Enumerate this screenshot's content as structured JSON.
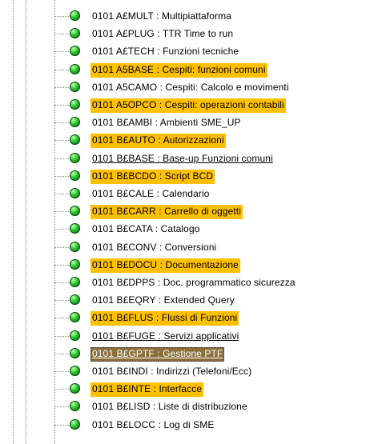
{
  "colors": {
    "highlight": "#ffc000",
    "selected_bg": "#8b6f3a",
    "selected_fg": "#ffffff",
    "bullet": "#1fae1f"
  },
  "icon": "green-ball-icon",
  "items": [
    {
      "label": "0101 A£MULT : Multipiattaforma",
      "style": "plain",
      "partial": "top"
    },
    {
      "label": "0101 A£PLUG : TTR Time to run",
      "style": "plain"
    },
    {
      "label": "0101 A£TECH : Funzioni tecniche",
      "style": "plain"
    },
    {
      "label": "0101 A5BASE : Cespiti: funzioni comuni",
      "style": "highlight"
    },
    {
      "label": "0101 A5CAMO : Cespiti: Calcolo e movimenti",
      "style": "plain"
    },
    {
      "label": "0101 A5OPCO : Cespiti: operazioni contabili",
      "style": "highlight"
    },
    {
      "label": "0101 B£AMBI : Ambienti SME_UP",
      "style": "plain"
    },
    {
      "label": "0101 B£AUTO : Autorizzazioni",
      "style": "highlight"
    },
    {
      "label": "0101 B£BASE : Base-up Funzioni comuni",
      "style": "underline"
    },
    {
      "label": "0101 B£BCDO : Script BCD",
      "style": "highlight"
    },
    {
      "label": "0101 B£CALE : Calendario",
      "style": "plain"
    },
    {
      "label": "0101 B£CARR : Carrello di oggetti",
      "style": "highlight"
    },
    {
      "label": "0101 B£CATA : Catalogo",
      "style": "plain"
    },
    {
      "label": "0101 B£CONV : Conversioni",
      "style": "plain"
    },
    {
      "label": "0101 B£DOCU : Documentazione",
      "style": "highlight"
    },
    {
      "label": "0101 B£DPPS : Doc. programmatico sicurezza",
      "style": "plain"
    },
    {
      "label": "0101 B£EQRY : Extended Query",
      "style": "plain"
    },
    {
      "label": "0101 B£FLUS : Flussi di Funzioni",
      "style": "highlight"
    },
    {
      "label": "0101 B£FUGE : Servizi applicativi",
      "style": "underline"
    },
    {
      "label": "0101 B£GPTF : Gestione PTF",
      "style": "selected"
    },
    {
      "label": "0101 B£INDI : Indirizzi (Telefoni/Ecc)",
      "style": "plain"
    },
    {
      "label": "0101 B£INTE : Interfacce",
      "style": "highlight"
    },
    {
      "label": "0101 B£LISD : Liste di distribuzione",
      "style": "plain"
    },
    {
      "label": "0101 B£LOCC : Log di SME",
      "style": "plain",
      "partial": "bottom"
    }
  ]
}
